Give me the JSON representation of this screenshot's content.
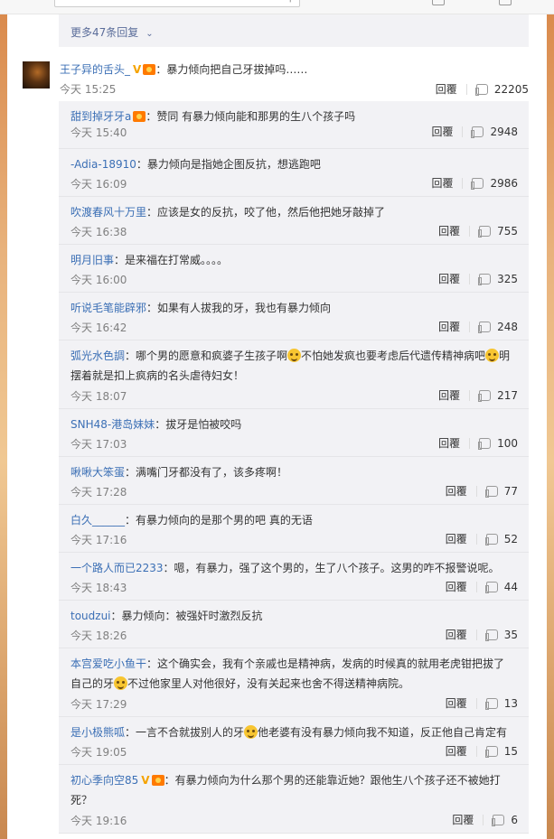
{
  "thread": {
    "more_replies": "更多47条回复"
  },
  "main_comment": {
    "user": "王子异的舌头_",
    "text": "：暴力倾向把自己牙拔掉吗……",
    "time": "今天 15:25",
    "reply_label": "回覆",
    "likes": "22205"
  },
  "replies": [
    {
      "user": "甜到掉牙牙a",
      "verified": false,
      "medal": true,
      "text": "：赞同 有暴力倾向能和那男的生八个孩子吗",
      "time": "今天 15:40",
      "reply_label": "回覆",
      "likes": "2948"
    },
    {
      "user": "-Adia-18910",
      "text": "：暴力倾向是指她企图反抗，想逃跑吧",
      "time": "今天 16:09",
      "reply_label": "回覆",
      "likes": "2986"
    },
    {
      "user": "吹渡春风十万里",
      "text": "：应该是女的反抗，咬了他，然后他把她牙敲掉了",
      "time": "今天 16:38",
      "reply_label": "回覆",
      "likes": "755"
    },
    {
      "user": "明月旧事",
      "text": "：是来福在打常威。。。。",
      "time": "今天 16:00",
      "reply_label": "回覆",
      "likes": "325"
    },
    {
      "user": "听说毛笔能辟邪",
      "text": "：如果有人拔我的牙，我也有暴力倾向",
      "time": "今天 16:42",
      "reply_label": "回覆",
      "likes": "248"
    },
    {
      "user": "弧光水色調",
      "text_a": "：哪个男的愿意和疯婆子生孩子啊",
      "text_b": "不怕她发疯也要考虑后代遗传精神病吧",
      "text_c": "明摆着就是扣上疯病的名头虐待妇女！",
      "time": "今天 18:07",
      "reply_label": "回覆",
      "likes": "217"
    },
    {
      "user": "SNH48-港岛妹妹",
      "text": "：拔牙是怕被咬吗",
      "time": "今天 17:03",
      "reply_label": "回覆",
      "likes": "100"
    },
    {
      "user": "啾啾大笨蛋",
      "text": "：满嘴门牙都没有了，该多疼啊！",
      "time": "今天 17:28",
      "reply_label": "回覆",
      "likes": "77"
    },
    {
      "user": "白久______",
      "text": "：有暴力倾向的是那个男的吧 真的无语",
      "time": "今天 17:16",
      "reply_label": "回覆",
      "likes": "52"
    },
    {
      "user": "一个路人而已2233",
      "text": "：嗯，有暴力，强了这个男的，生了八个孩子。这男的咋不报警说呢。",
      "time": "今天 18:43",
      "reply_label": "回覆",
      "likes": "44"
    },
    {
      "user": "toudzui",
      "text": "：暴力倾向：被强奸时激烈反抗",
      "time": "今天 18:26",
      "reply_label": "回覆",
      "likes": "35"
    },
    {
      "user": "本宫爱吃小鱼干",
      "text_a": "：这个确实会，我有个亲戚也是精神病，发病的时候真的就用老虎钳把拔了自己的牙",
      "text_b": "不过他家里人对他很好，没有关起来也舍不得送精神病院。",
      "time": "今天 17:29",
      "reply_label": "回覆",
      "likes": "13"
    },
    {
      "user": "是小极熊呱",
      "text_a": "：一言不合就拔别人的牙",
      "text_b": "他老婆有没有暴力倾向我不知道，反正他自己肯定有",
      "time": "今天 19:05",
      "reply_label": "回覆",
      "likes": "15"
    },
    {
      "user": "初心季向空85",
      "text": "：有暴力倾向为什么那个男的还能靠近她？跟他生八个孩子还不被她打死？",
      "time": "今天 19:16",
      "reply_label": "回覆",
      "likes": "6"
    }
  ]
}
